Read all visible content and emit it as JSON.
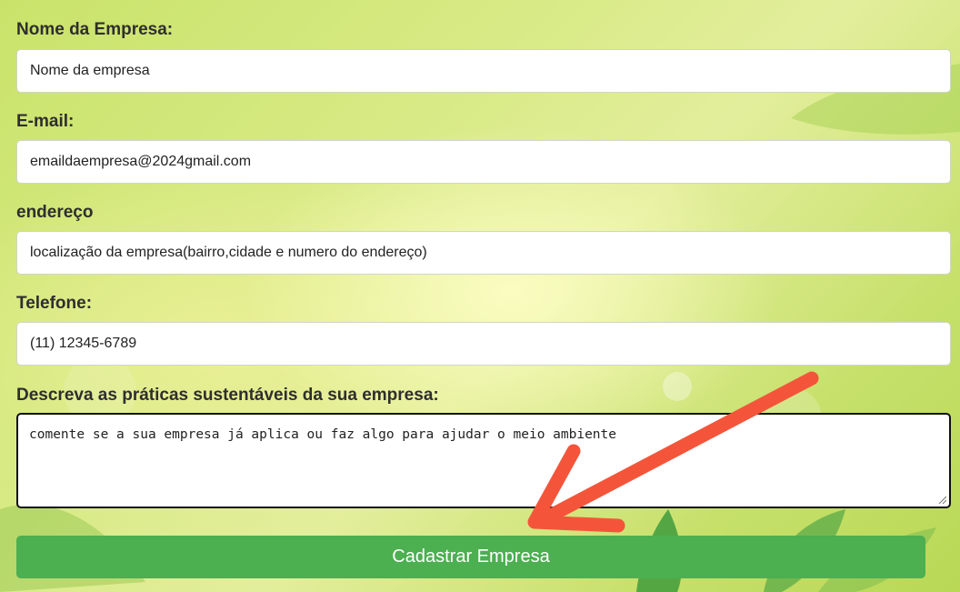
{
  "form": {
    "company_name": {
      "label": "Nome da Empresa:",
      "value": "Nome da empresa"
    },
    "email": {
      "label": "E-mail:",
      "value": "emaildaempresa@2024gmail.com"
    },
    "address": {
      "label": "endereço",
      "value": "localização da empresa(bairro,cidade e numero do endereço)"
    },
    "phone": {
      "label": "Telefone:",
      "value": "(11) 12345-6789"
    },
    "practices": {
      "label": "Descreva as práticas sustentáveis da sua empresa:",
      "value": "comente se a sua empresa já aplica ou faz algo para ajudar o meio ambiente"
    },
    "submit_label": "Cadastrar Empresa"
  },
  "colors": {
    "submit_button": "#4caf50",
    "annotation_arrow": "#f4553a",
    "background": "#d8ea86"
  },
  "icons": {
    "textarea_resize": "resize-grip-icon",
    "annotation": "red-arrow-icon"
  }
}
